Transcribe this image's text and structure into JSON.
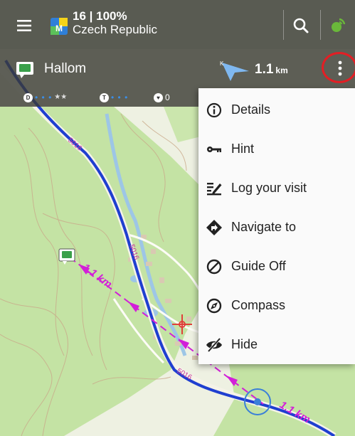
{
  "top_bar": {
    "menu_icon": "hamburger-icon",
    "zoom_info": "16 | 100%",
    "map_name": "Czech Republic",
    "search_icon": "search-icon",
    "gps_icon": "satellite-icon"
  },
  "guide_bar": {
    "geocache_icon": "geocache-icon",
    "target_name": "Hallom",
    "direction_icon": "direction-arrow-icon",
    "distance_value": "1.1",
    "distance_unit": "km",
    "more_icon": "more-vertical-icon"
  },
  "cache_stats": {
    "difficulty_label": "D",
    "terrain_label": "T",
    "favorites_count": "0"
  },
  "map_labels": {
    "road_label": "5016",
    "distance_label": "1.1 km"
  },
  "overflow_menu": {
    "items": [
      {
        "label": "Details",
        "icon": "info-icon"
      },
      {
        "label": "Hint",
        "icon": "key-icon"
      },
      {
        "label": "Log your visit",
        "icon": "log-icon"
      },
      {
        "label": "Navigate to",
        "icon": "navigate-icon"
      },
      {
        "label": "Guide Off",
        "icon": "guide-off-icon"
      },
      {
        "label": "Compass",
        "icon": "compass-icon"
      },
      {
        "label": "Hide",
        "icon": "hide-icon"
      }
    ]
  },
  "colors": {
    "route_blue": "#1f3fd0",
    "guide_magenta": "#d21fd8",
    "highlight_red": "#e31e24"
  }
}
